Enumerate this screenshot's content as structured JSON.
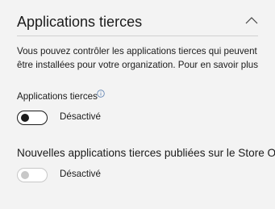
{
  "section": {
    "title": "Applications tierces",
    "collapse_icon": "chevron-up-icon"
  },
  "description": {
    "line1": "Vous pouvez contrôler les applications tierces qui peuvent",
    "line2": "être installées pour votre organization. ",
    "link": "Pour en savoir plus"
  },
  "third_party_apps": {
    "label": "Applications tierces",
    "info_icon": "info-icon",
    "toggle_on": false,
    "toggle_enabled": true,
    "state_label": "Désactivé"
  },
  "new_store_apps": {
    "label": "Nouvelles applications tierces publiées sur le Store O",
    "toggle_on": false,
    "toggle_enabled": false,
    "state_label": "Désactivé"
  }
}
